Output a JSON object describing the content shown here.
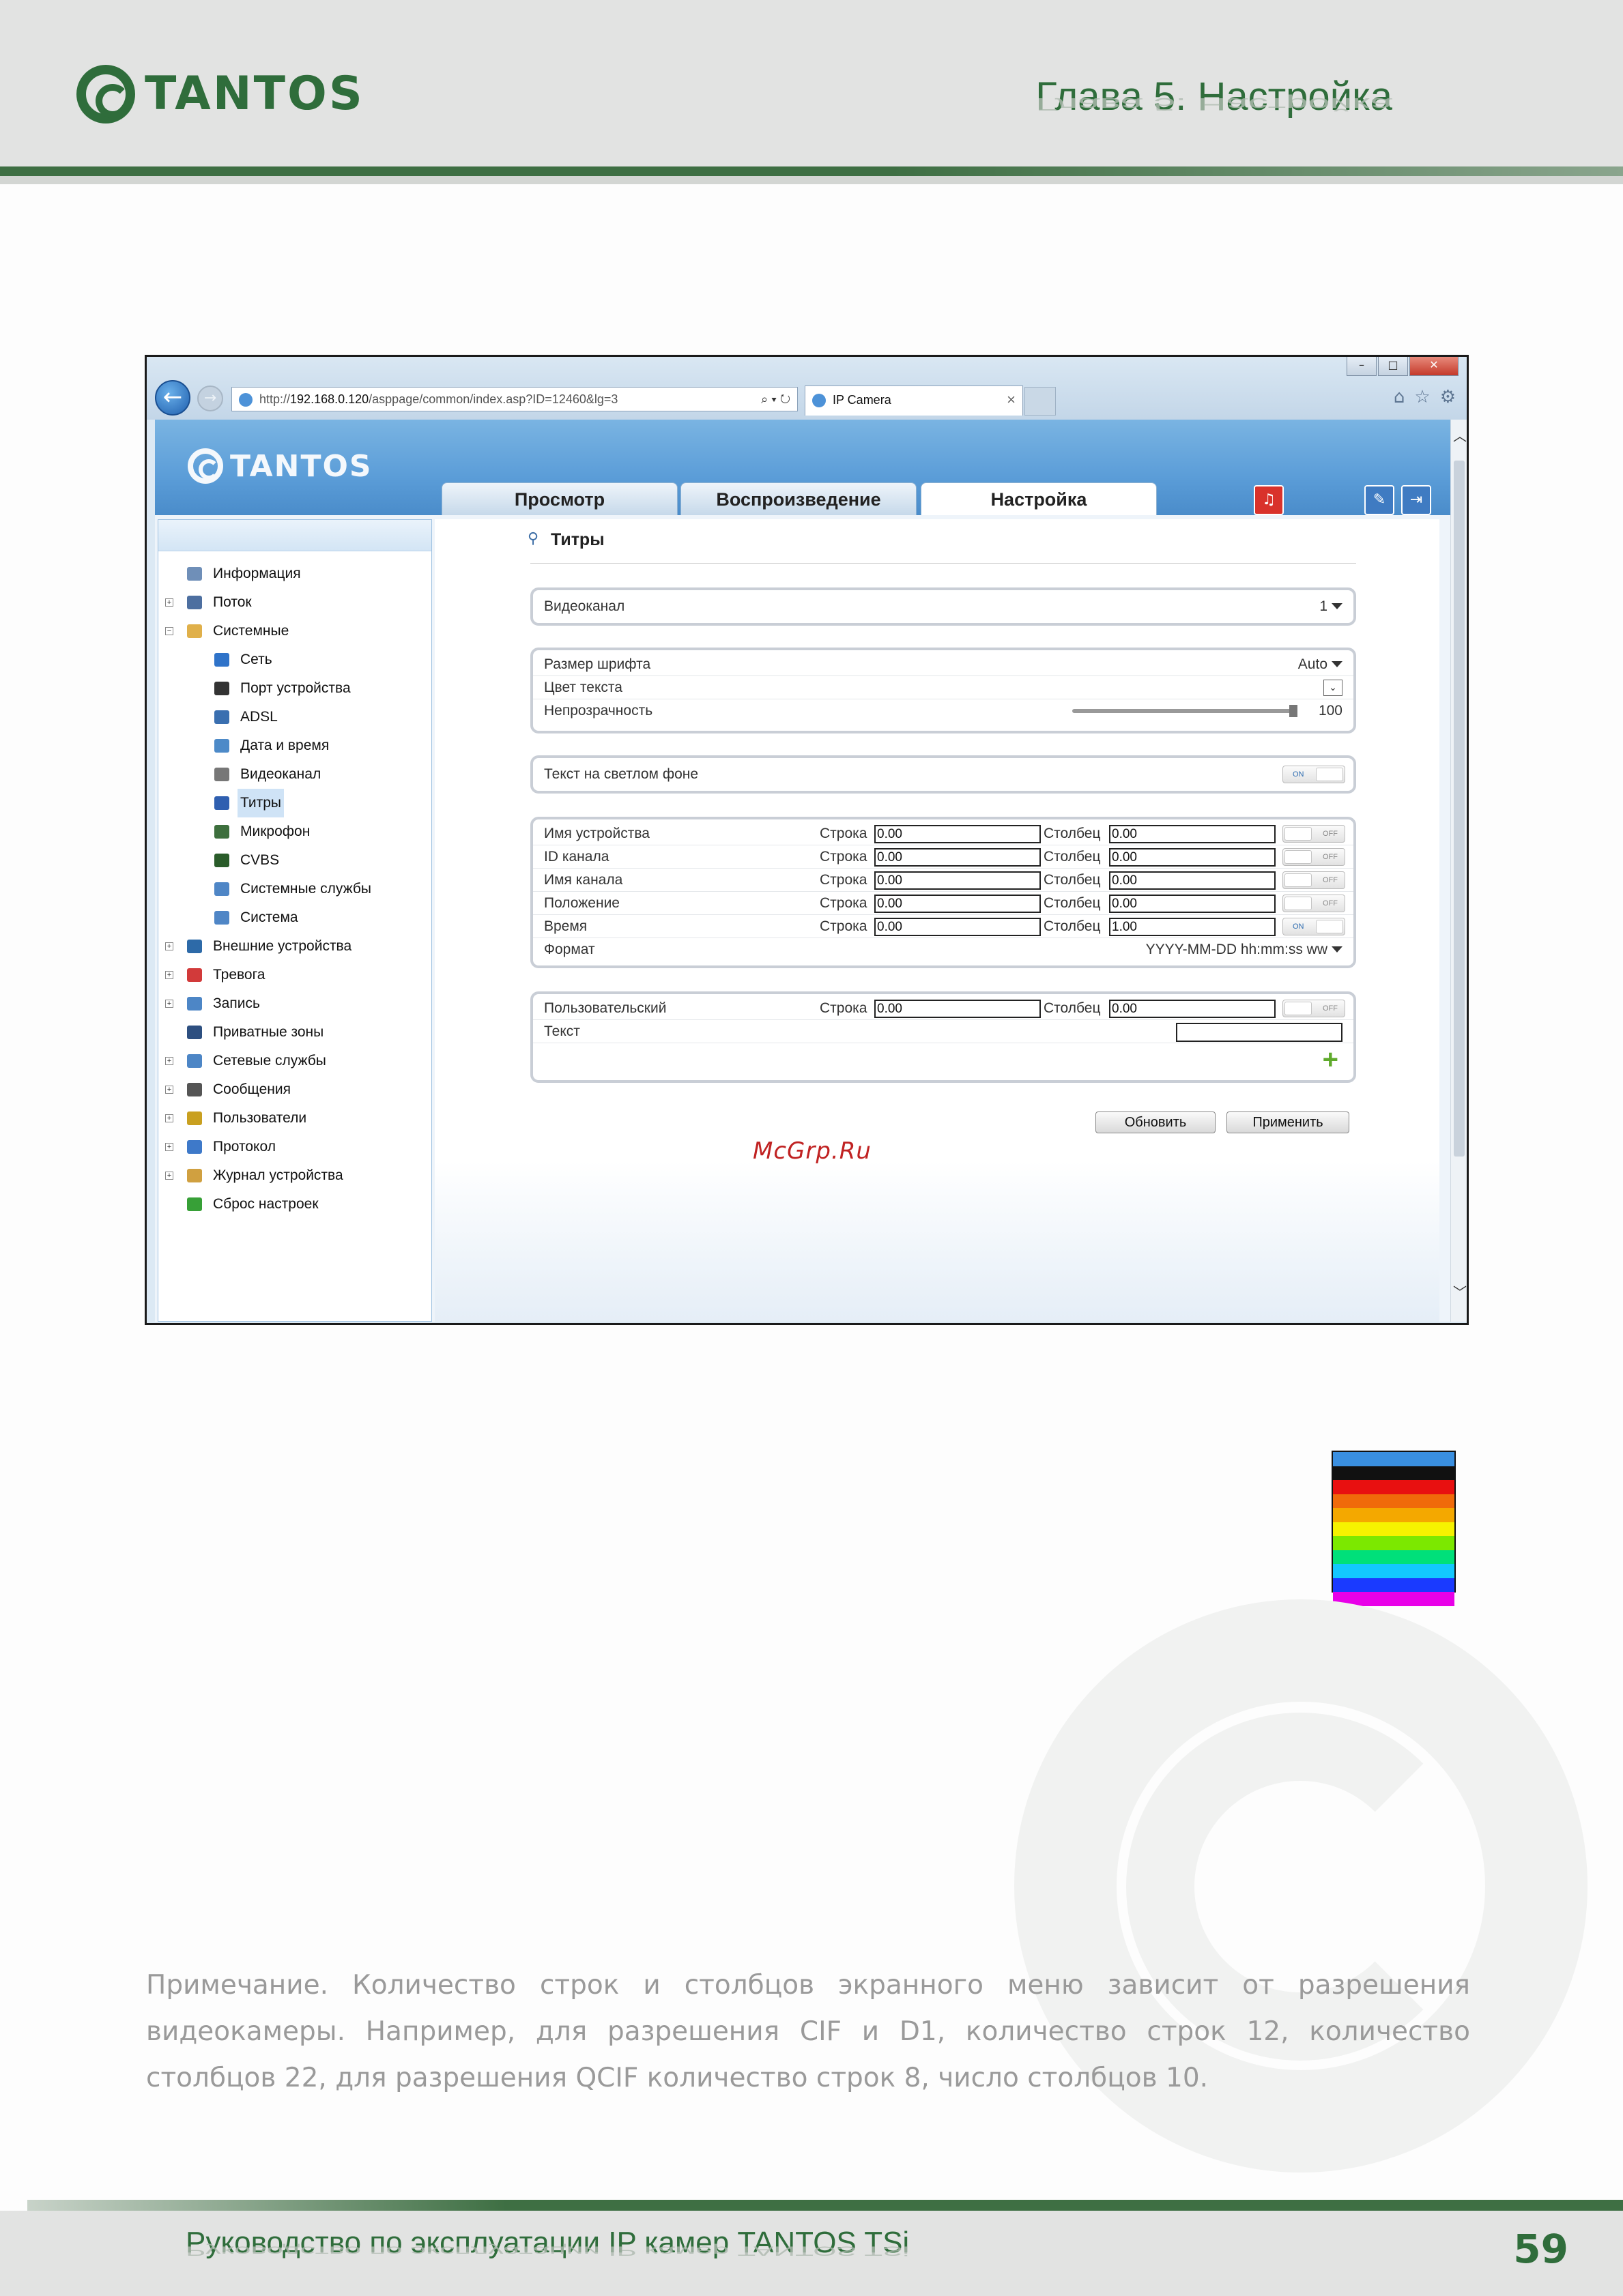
{
  "header": {
    "logo_text": "TANTOS",
    "chapter_title": "Глава 5. Настройка"
  },
  "browser": {
    "address_prefix": "http://",
    "address_host": "192.168.0.120",
    "address_path": "/asppage/common/index.asp?ID=12460&lg=3",
    "tab_title": "IP Camera",
    "tab_close": "×",
    "window_buttons": [
      "–",
      "□",
      "✕"
    ]
  },
  "app": {
    "logo_text": "TANTOS",
    "tabs": [
      "Просмотр",
      "Воспроизведение",
      "Настройка"
    ],
    "active_tab": "Настройка"
  },
  "sidebar": {
    "items": [
      {
        "label": "Информация",
        "level": 0,
        "expander": "",
        "icon": "info-icon"
      },
      {
        "label": "Поток",
        "level": 0,
        "expander": "+",
        "icon": "stream-icon"
      },
      {
        "label": "Системные",
        "level": 0,
        "expander": "−",
        "icon": "folder-icon"
      },
      {
        "label": "Сеть",
        "level": 1,
        "expander": "",
        "icon": "network-icon"
      },
      {
        "label": "Порт устройства",
        "level": 1,
        "expander": "",
        "icon": "port-icon"
      },
      {
        "label": "ADSL",
        "level": 1,
        "expander": "",
        "icon": "adsl-icon"
      },
      {
        "label": "Дата и время",
        "level": 1,
        "expander": "",
        "icon": "clock-icon"
      },
      {
        "label": "Видеоканал",
        "level": 1,
        "expander": "",
        "icon": "camera-icon"
      },
      {
        "label": "Титры",
        "level": 1,
        "expander": "",
        "icon": "titles-icon",
        "selected": true
      },
      {
        "label": "Микрофон",
        "level": 1,
        "expander": "",
        "icon": "microphone-icon"
      },
      {
        "label": "CVBS",
        "level": 1,
        "expander": "",
        "icon": "cvbs-icon"
      },
      {
        "label": "Системные службы",
        "level": 1,
        "expander": "",
        "icon": "services-icon"
      },
      {
        "label": "Система",
        "level": 1,
        "expander": "",
        "icon": "system-icon"
      },
      {
        "label": "Внешние устройства",
        "level": 0,
        "expander": "+",
        "icon": "external-devices-icon"
      },
      {
        "label": "Тревога",
        "level": 0,
        "expander": "+",
        "icon": "alarm-icon"
      },
      {
        "label": "Запись",
        "level": 0,
        "expander": "+",
        "icon": "record-icon"
      },
      {
        "label": "Приватные зоны",
        "level": 0,
        "expander": "",
        "icon": "privacy-icon"
      },
      {
        "label": "Сетевые службы",
        "level": 0,
        "expander": "+",
        "icon": "network-services-icon"
      },
      {
        "label": "Сообщения",
        "level": 0,
        "expander": "+",
        "icon": "messages-icon"
      },
      {
        "label": "Пользователи",
        "level": 0,
        "expander": "+",
        "icon": "users-icon"
      },
      {
        "label": "Протокол",
        "level": 0,
        "expander": "+",
        "icon": "protocol-icon"
      },
      {
        "label": "Журнал устройства",
        "level": 0,
        "expander": "+",
        "icon": "log-icon"
      },
      {
        "label": "Сброс настроек",
        "level": 0,
        "expander": "",
        "icon": "reset-icon"
      }
    ]
  },
  "content": {
    "title": "Титры",
    "videochannel": {
      "label": "Видеоканал",
      "value": "1"
    },
    "font": {
      "size_label": "Размер шрифта",
      "size_value": "Auto",
      "color_label": "Цвет текста",
      "opacity_label": "Непрозрачность",
      "opacity_value": "100",
      "opacity_level": 1.0
    },
    "light_bg": {
      "label": "Текст на светлом фоне",
      "state": "ON"
    },
    "overlay_rows": [
      {
        "label": "Имя устройства",
        "row_label": "Строка",
        "row": "0.00",
        "col_label": "Столбец",
        "col": "0.00",
        "state": "OFF"
      },
      {
        "label": "ID канала",
        "row_label": "Строка",
        "row": "0.00",
        "col_label": "Столбец",
        "col": "0.00",
        "state": "OFF"
      },
      {
        "label": "Имя канала",
        "row_label": "Строка",
        "row": "0.00",
        "col_label": "Столбец",
        "col": "0.00",
        "state": "OFF"
      },
      {
        "label": "Положение",
        "row_label": "Строка",
        "row": "0.00",
        "col_label": "Столбец",
        "col": "0.00",
        "state": "OFF"
      },
      {
        "label": "Время",
        "row_label": "Строка",
        "row": "0.00",
        "col_label": "Столбец",
        "col": "1.00",
        "state": "ON"
      }
    ],
    "format": {
      "label": "Формат",
      "value": "YYYY-MM-DD hh:mm:ss ww"
    },
    "custom": {
      "label": "Пользовательский",
      "row_label": "Строка",
      "row": "0.00",
      "col_label": "Столбец",
      "col": "0.00",
      "state": "OFF",
      "text_label": "Текст",
      "text_value": ""
    },
    "buttons": {
      "refresh": "Обновить",
      "apply": "Применить"
    }
  },
  "watermark": "McGrp.Ru",
  "color_bar": [
    "#3a8fe0",
    "#111111",
    "#e81010",
    "#f06a0a",
    "#f4a800",
    "#f6f200",
    "#7ce800",
    "#00e07a",
    "#12c8ff",
    "#1a3aff",
    "#e800e8"
  ],
  "note": "Примечание. Количество строк и столбцов экранного меню зависит от разрешения видеокамеры. Например, для разрешения CIF и D1, количество строк 12, количество столбцов 22, для разрешения QCIF количество строк 8, число столбцов 10.",
  "footer": {
    "text": "Руководство по эксплуатации IP камер TANTOS TSi",
    "page_number": "59"
  }
}
